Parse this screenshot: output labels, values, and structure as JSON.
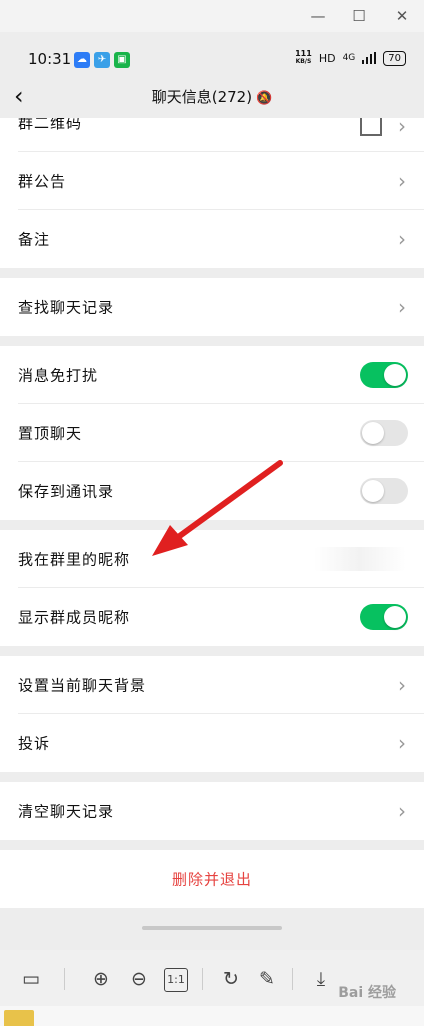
{
  "window": {
    "minimize_label": "—",
    "maximize_label": "☐",
    "close_label": "✕"
  },
  "status": {
    "time": "10:31",
    "net_speed_value": "111",
    "net_speed_unit": "KB/S",
    "hd": "HD",
    "network": "4G",
    "battery": "70"
  },
  "nav": {
    "title": "聊天信息(272)"
  },
  "sections": {
    "group_qr_label": "群二维码",
    "announcement_label": "群公告",
    "remark_label": "备注",
    "search_history_label": "查找聊天记录",
    "mute_label": "消息免打扰",
    "mute_on": true,
    "pin_label": "置顶聊天",
    "pin_on": false,
    "save_contacts_label": "保存到通讯录",
    "save_contacts_on": false,
    "my_nickname_label": "我在群里的昵称",
    "show_nicknames_label": "显示群成员昵称",
    "show_nicknames_on": true,
    "background_label": "设置当前聊天背景",
    "complain_label": "投诉",
    "clear_history_label": "清空聊天记录",
    "delete_exit_label": "删除并退出"
  },
  "toolbar": {
    "ratio_label": "1:1"
  },
  "watermark": "Bai 经验",
  "colors": {
    "accent_green": "#07c160",
    "danger_red": "#e64340",
    "arrow_red": "#e02020"
  }
}
